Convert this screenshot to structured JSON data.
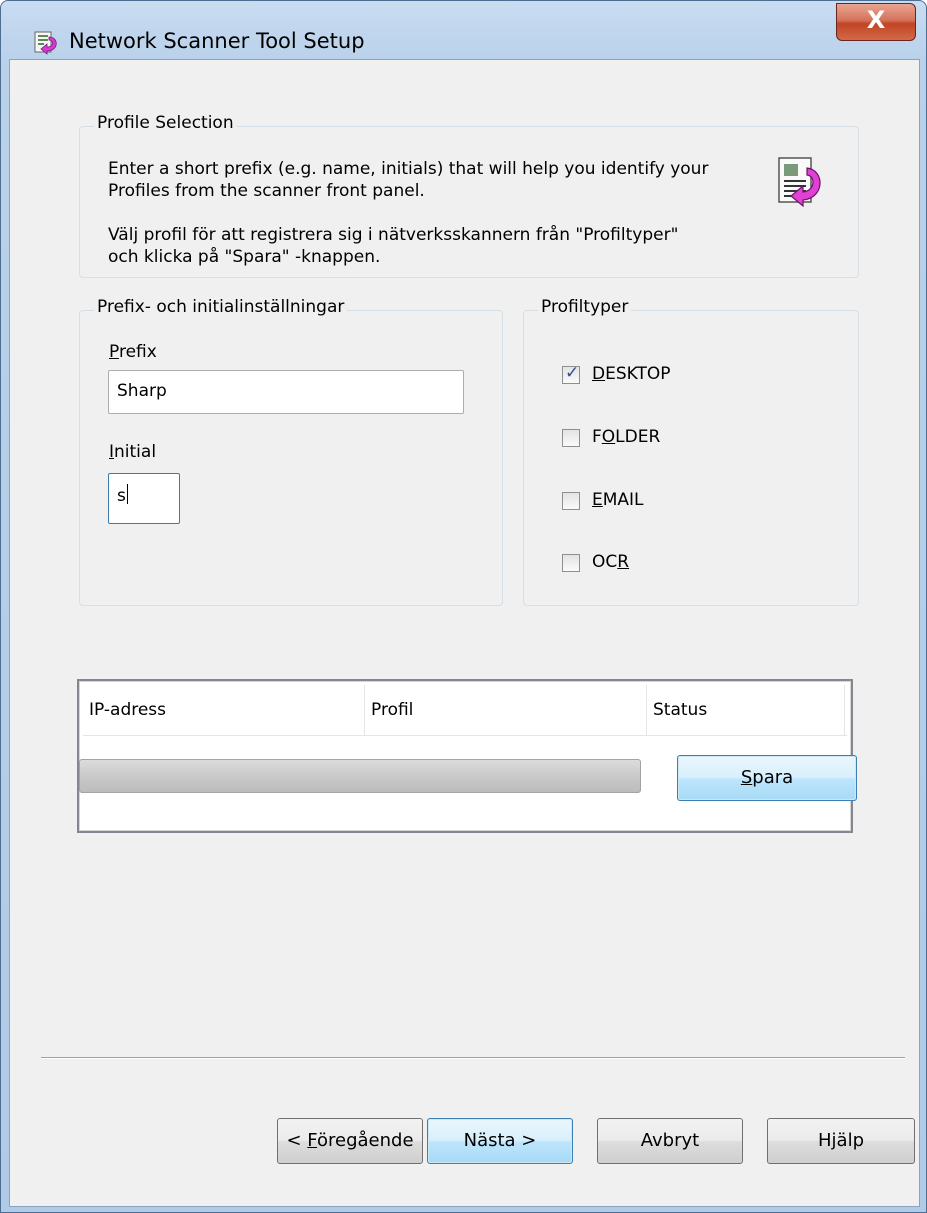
{
  "window": {
    "title": "Network Scanner Tool Setup",
    "close_label": "X"
  },
  "profile_selection": {
    "legend": "Profile Selection",
    "line1": "Enter a short prefix (e.g. name, initials) that will help you identify your",
    "line2": "Profiles from the scanner front panel.",
    "line3": "Välj profil för att registrera sig i nätverksskannern från \"Profiltyper\"",
    "line4": "och klicka på \"Spara\" -knappen."
  },
  "prefix_group": {
    "legend": "Prefix- och  initialinställningar",
    "prefix_label_first": "P",
    "prefix_label_rest": "refix",
    "prefix_value": "Sharp",
    "initial_label_first": "I",
    "initial_label_rest": "nitial",
    "initial_value": "s"
  },
  "profile_types": {
    "legend": "Profiltyper",
    "items": [
      {
        "pre": "",
        "mnemonic": "D",
        "post": "ESKTOP",
        "checked": true
      },
      {
        "pre": "F",
        "mnemonic": "O",
        "post": "LDER",
        "checked": false
      },
      {
        "pre": "",
        "mnemonic": "E",
        "post": "MAIL",
        "checked": false
      },
      {
        "pre": "OC",
        "mnemonic": "R",
        "post": "",
        "checked": false
      }
    ]
  },
  "list": {
    "columns": [
      "IP-adress",
      "Profil",
      "Status"
    ]
  },
  "progress": {
    "value": 0
  },
  "buttons": {
    "save_mnemonic": "S",
    "save_rest": "para",
    "back_prefix": "< ",
    "back_mnemonic": "F",
    "back_rest": "öregående",
    "next": "Nästa >",
    "cancel": "Avbryt",
    "help": "Hjälp"
  }
}
